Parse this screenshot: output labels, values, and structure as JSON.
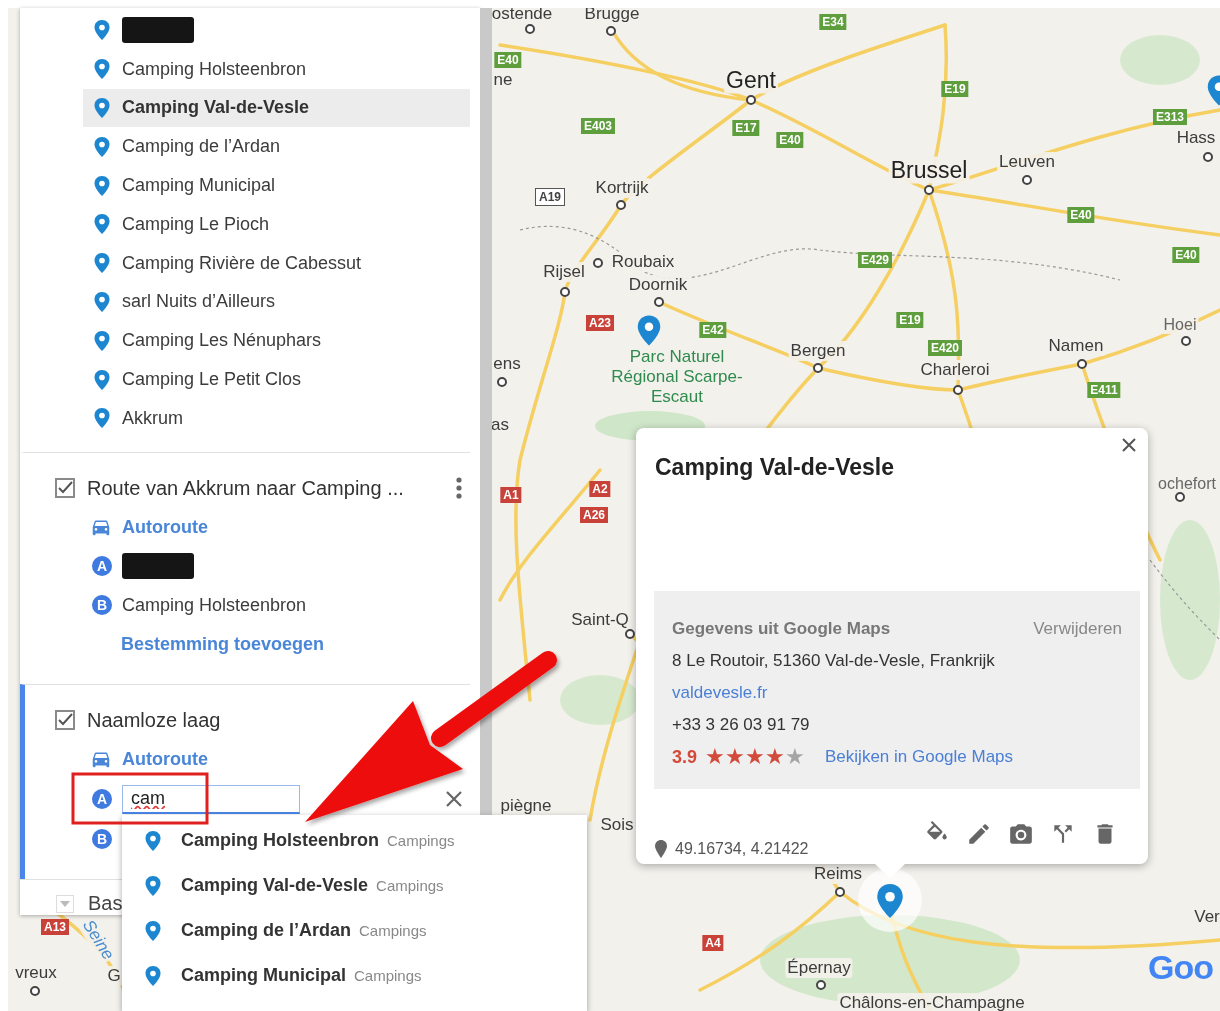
{
  "places_layer": {
    "items": [
      {
        "kind": "redacted",
        "selected": false
      },
      {
        "kind": "place",
        "label": "Camping Holsteenbron",
        "selected": false
      },
      {
        "kind": "place",
        "label": "Camping Val-de-Vesle",
        "selected": true
      },
      {
        "kind": "place",
        "label": "Camping de l’Ardan",
        "selected": false
      },
      {
        "kind": "place",
        "label": "Camping Municipal",
        "selected": false
      },
      {
        "kind": "place",
        "label": "Camping Le Pioch",
        "selected": false
      },
      {
        "kind": "place",
        "label": "Camping Rivière de Cabessut",
        "selected": false
      },
      {
        "kind": "place",
        "label": "sarl Nuits d’Ailleurs",
        "selected": false
      },
      {
        "kind": "place",
        "label": "Camping Les Nénuphars",
        "selected": false
      },
      {
        "kind": "place",
        "label": "Camping Le Petit Clos",
        "selected": false
      },
      {
        "kind": "place",
        "label": "Akkrum",
        "selected": false
      }
    ]
  },
  "route_layer": {
    "title": "Route van Akkrum naar Camping ...",
    "checked": true,
    "active": false,
    "mode": "Autoroute",
    "stops": [
      {
        "letter": "A",
        "kind": "redacted"
      },
      {
        "letter": "B",
        "kind": "place",
        "label": "Camping Holsteenbron"
      }
    ],
    "add_stop": "Bestemming toevoegen"
  },
  "new_layer": {
    "title": "Naamloze laag",
    "checked": true,
    "active": true,
    "mode": "Autoroute",
    "stops": [
      {
        "letter": "A",
        "kind": "input",
        "value": "cam"
      },
      {
        "letter": "B",
        "kind": "empty"
      }
    ]
  },
  "base_layer": {
    "title": "Bas"
  },
  "suggestions": [
    {
      "name": "Camping Holsteenbron",
      "category": "Campings"
    },
    {
      "name": "Camping Val-de-Vesle",
      "category": "Campings"
    },
    {
      "name": "Camping de l’Ardan",
      "category": "Campings"
    },
    {
      "name": "Camping Municipal",
      "category": "Campings"
    }
  ],
  "popup": {
    "title": "Camping Val-de-Vesle",
    "source": "Gegevens uit Google Maps",
    "remove": "Verwijderen",
    "address": "8 Le Routoir, 51360 Val-de-Vesle, Frankrijk",
    "website": "valdevesle.fr",
    "phone": "+33 3 26 03 91 79",
    "rating": "3.9",
    "stars": 4,
    "maps_link": "Bekijken in Google Maps",
    "coordinates": "49.16734, 4.21422"
  },
  "map": {
    "labels": [
      {
        "kind": "town",
        "text": "ostende"
      },
      {
        "kind": "town",
        "text": "Brugge"
      },
      {
        "kind": "town",
        "text": "ne"
      },
      {
        "kind": "city",
        "text": "Gent"
      },
      {
        "kind": "city",
        "text": "Brussel"
      },
      {
        "kind": "town",
        "text": "Leuven"
      },
      {
        "kind": "town",
        "text": "Hass"
      },
      {
        "kind": "town",
        "text": "Kortrijk"
      },
      {
        "kind": "town",
        "text": "Rijsel"
      },
      {
        "kind": "town",
        "text": "Roubaix"
      },
      {
        "kind": "town",
        "text": "Doornik"
      },
      {
        "kind": "park",
        "text": "Parc Naturel Régional Scarpe-Escaut"
      },
      {
        "kind": "town",
        "text": "Bergen"
      },
      {
        "kind": "town",
        "text": "Charleroi"
      },
      {
        "kind": "town",
        "text": "Namen"
      },
      {
        "kind": "minor",
        "text": "Hoei"
      },
      {
        "kind": "town",
        "text": "ens"
      },
      {
        "kind": "town",
        "text": "as"
      },
      {
        "kind": "minor",
        "text": "ochefort"
      },
      {
        "kind": "town",
        "text": "Saint-Q"
      },
      {
        "kind": "town",
        "text": "piègne"
      },
      {
        "kind": "town",
        "text": "Sois"
      },
      {
        "kind": "town",
        "text": "Reims"
      },
      {
        "kind": "town",
        "text": "Épernay"
      },
      {
        "kind": "town",
        "text": "Châlons-en-Champagne"
      },
      {
        "kind": "town",
        "text": "Ver"
      },
      {
        "kind": "town",
        "text": "vreux"
      },
      {
        "kind": "river",
        "text": "Seine"
      },
      {
        "kind": "town",
        "text": "G"
      }
    ],
    "shields": [
      {
        "kind": "european",
        "text": "E34"
      },
      {
        "kind": "european",
        "text": "E40"
      },
      {
        "kind": "european",
        "text": "E19"
      },
      {
        "kind": "european",
        "text": "E313"
      },
      {
        "kind": "european",
        "text": "E403"
      },
      {
        "kind": "european",
        "text": "E17"
      },
      {
        "kind": "european",
        "text": "E40"
      },
      {
        "kind": "national",
        "text": "A19"
      },
      {
        "kind": "european",
        "text": "E40"
      },
      {
        "kind": "european",
        "text": "E429"
      },
      {
        "kind": "european",
        "text": "E40"
      },
      {
        "kind": "motorway",
        "text": "A23"
      },
      {
        "kind": "european",
        "text": "E42"
      },
      {
        "kind": "european",
        "text": "E19"
      },
      {
        "kind": "european",
        "text": "E420"
      },
      {
        "kind": "european",
        "text": "E411"
      },
      {
        "kind": "motorway",
        "text": "A1"
      },
      {
        "kind": "motorway",
        "text": "A2"
      },
      {
        "kind": "motorway",
        "text": "A26"
      },
      {
        "kind": "motorway",
        "text": "A13"
      },
      {
        "kind": "motorway",
        "text": "A4"
      }
    ],
    "logo": "Goo"
  }
}
